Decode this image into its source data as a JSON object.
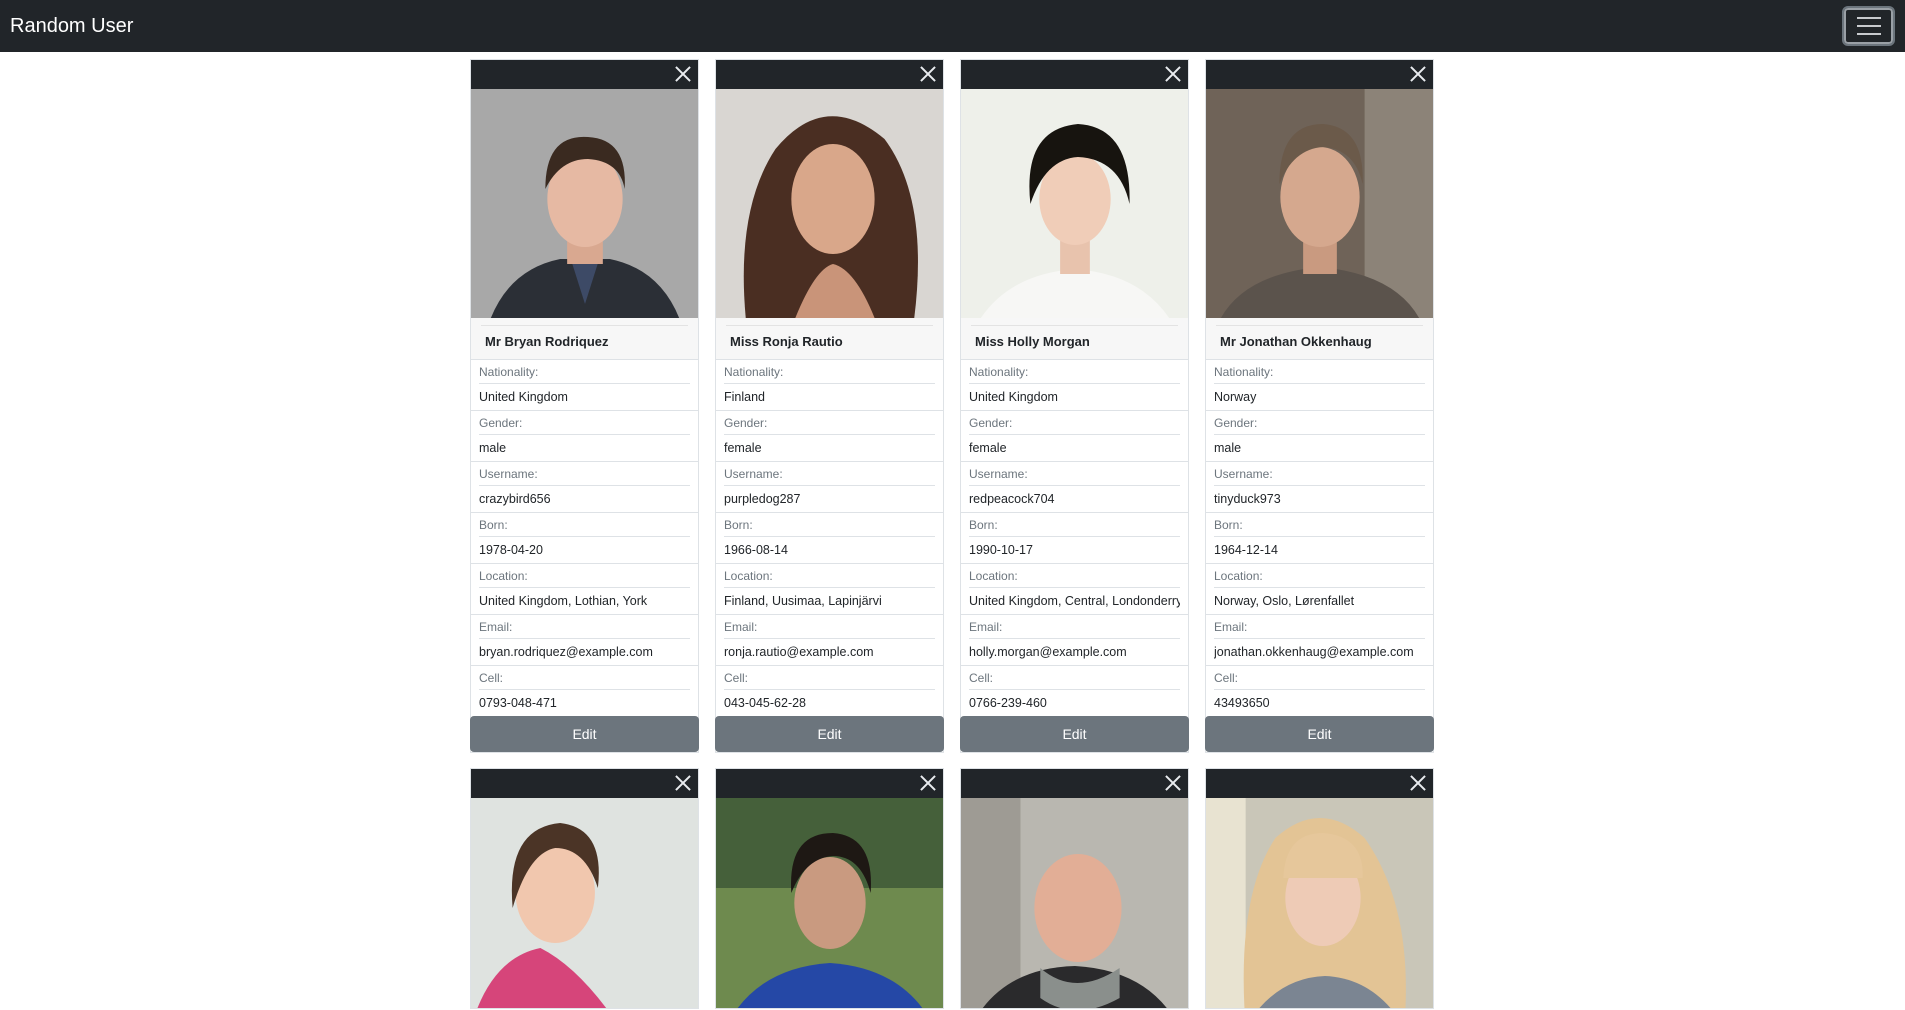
{
  "app": {
    "title": "Random User"
  },
  "cards": [
    {
      "name": "Mr Bryan Rodriquez",
      "fields": [
        {
          "label": "Nationality:",
          "value": "United Kingdom"
        },
        {
          "label": "Gender:",
          "value": "male"
        },
        {
          "label": "Username:",
          "value": "crazybird656"
        },
        {
          "label": "Born:",
          "value": "1978-04-20"
        },
        {
          "label": "Location:",
          "value": "United Kingdom, Lothian, York"
        },
        {
          "label": "Email:",
          "value": "bryan.rodriquez@example.com"
        },
        {
          "label": "Cell:",
          "value": "0793-048-471"
        }
      ],
      "edit_label": "Edit"
    },
    {
      "name": "Miss Ronja Rautio",
      "fields": [
        {
          "label": "Nationality:",
          "value": "Finland"
        },
        {
          "label": "Gender:",
          "value": "female"
        },
        {
          "label": "Username:",
          "value": "purpledog287"
        },
        {
          "label": "Born:",
          "value": "1966-08-14"
        },
        {
          "label": "Location:",
          "value": "Finland, Uusimaa, Lapinjärvi"
        },
        {
          "label": "Email:",
          "value": "ronja.rautio@example.com"
        },
        {
          "label": "Cell:",
          "value": "043-045-62-28"
        }
      ],
      "edit_label": "Edit"
    },
    {
      "name": "Miss Holly Morgan",
      "fields": [
        {
          "label": "Nationality:",
          "value": "United Kingdom"
        },
        {
          "label": "Gender:",
          "value": "female"
        },
        {
          "label": "Username:",
          "value": "redpeacock704"
        },
        {
          "label": "Born:",
          "value": "1990-10-17"
        },
        {
          "label": "Location:",
          "value": "United Kingdom, Central, Londonderry"
        },
        {
          "label": "Email:",
          "value": "holly.morgan@example.com"
        },
        {
          "label": "Cell:",
          "value": "0766-239-460"
        }
      ],
      "edit_label": "Edit"
    },
    {
      "name": "Mr Jonathan Okkenhaug",
      "fields": [
        {
          "label": "Nationality:",
          "value": "Norway"
        },
        {
          "label": "Gender:",
          "value": "male"
        },
        {
          "label": "Username:",
          "value": "tinyduck973"
        },
        {
          "label": "Born:",
          "value": "1964-12-14"
        },
        {
          "label": "Location:",
          "value": "Norway, Oslo, Lørenfallet"
        },
        {
          "label": "Email:",
          "value": "jonathan.okkenhaug@example.com"
        },
        {
          "label": "Cell:",
          "value": "43493650"
        }
      ],
      "edit_label": "Edit"
    }
  ],
  "icons": {
    "close": "close-icon",
    "menu": "menu-icon"
  },
  "colors": {
    "navbar": "#212529",
    "edit_button": "#6c757d",
    "card_border": "#dee2e6"
  }
}
